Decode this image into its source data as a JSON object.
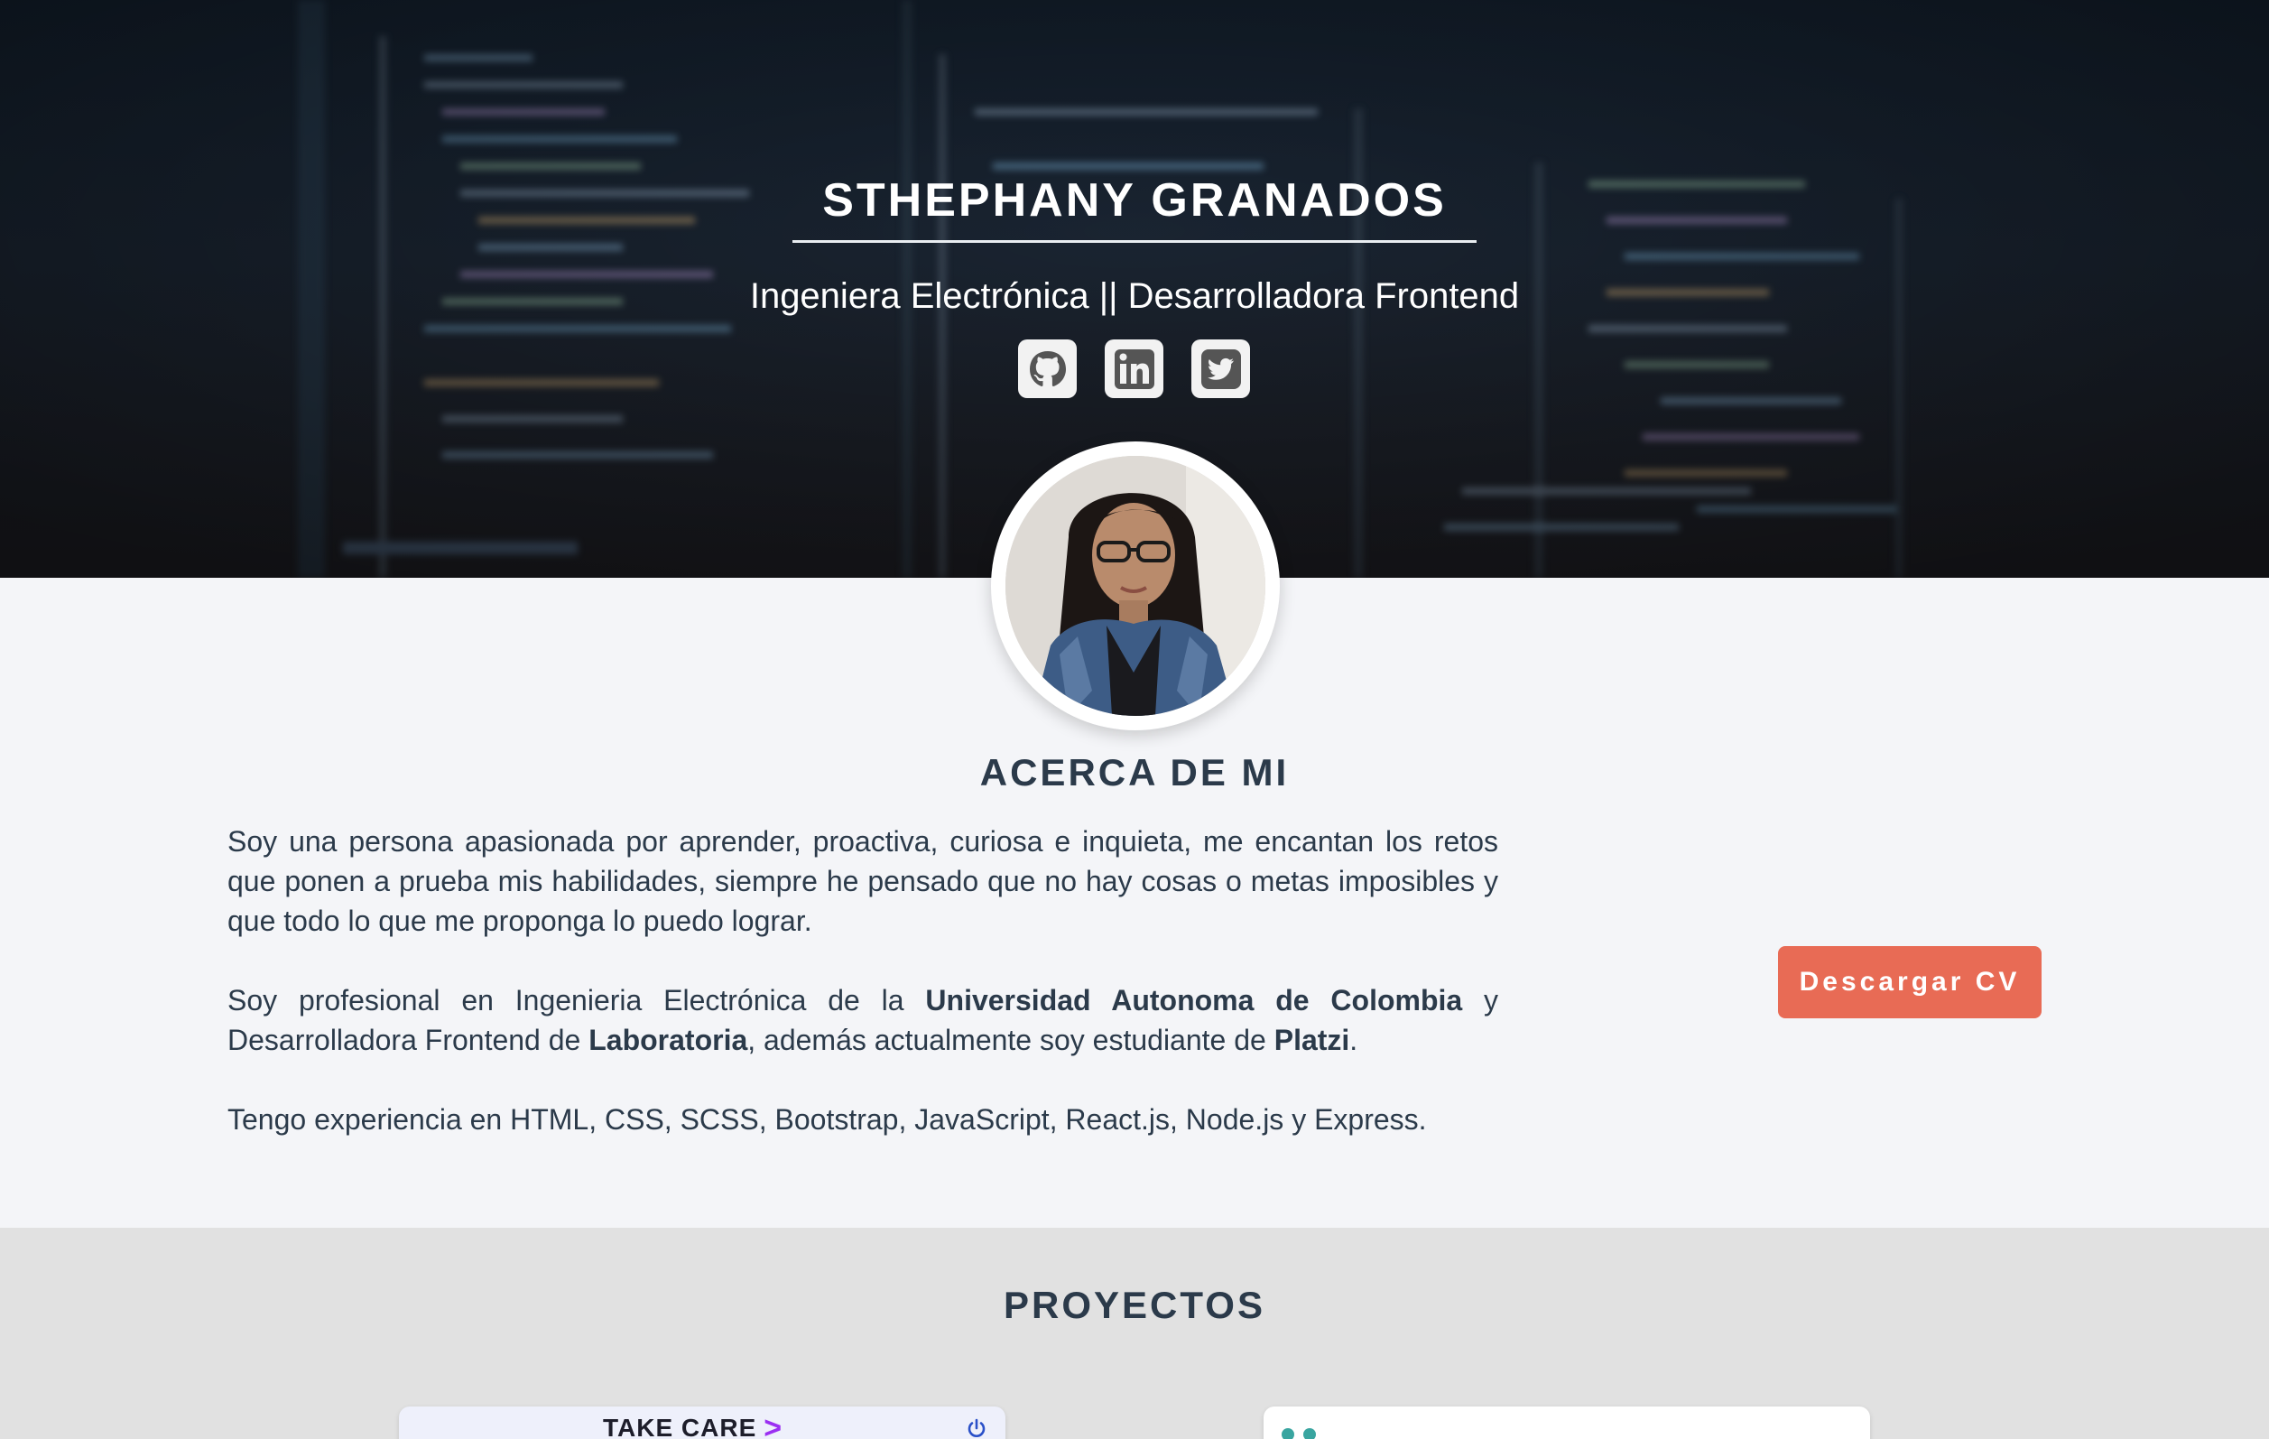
{
  "hero": {
    "name": "STHEPHANY GRANADOS",
    "subtitle": "Ingeniera Electrónica || Desarrolladora Frontend",
    "socials": [
      {
        "icon": "github-icon"
      },
      {
        "icon": "linkedin-icon"
      },
      {
        "icon": "twitter-icon"
      }
    ]
  },
  "about": {
    "title": "ACERCA DE MI",
    "p1": "Soy una persona apasionada por aprender, proactiva, curiosa e inquieta, me encantan los retos que ponen a prueba mis habilidades, siempre he pensado que no hay cosas o metas imposibles y que todo lo que me proponga lo puedo lograr.",
    "p2_a": "Soy profesional en Ingenieria Electrónica de la ",
    "p2_b": "Universidad Autonoma de Colombia",
    "p2_c": " y Desarrolladora Frontend de ",
    "p2_d": "Laboratoria",
    "p2_e": ", además actualmente soy estudiante de ",
    "p2_f": "Platzi",
    "p2_g": ".",
    "p3": "Tengo experiencia en HTML, CSS, SCSS, Bootstrap, JavaScript, React.js, Node.js y Express.",
    "cv_button": "Descargar CV"
  },
  "projects": {
    "title": "PROYECTOS",
    "cards": [
      {
        "brand": "TAKE CARE",
        "brand_mark": ">"
      },
      {
        "brand": ""
      }
    ]
  },
  "colors": {
    "accent": "#e86b55",
    "heading": "#2b3a4a",
    "page_bg": "#f4f5f8",
    "projects_bg": "#e1e1e1",
    "brand_purple": "#9b2ff2"
  }
}
